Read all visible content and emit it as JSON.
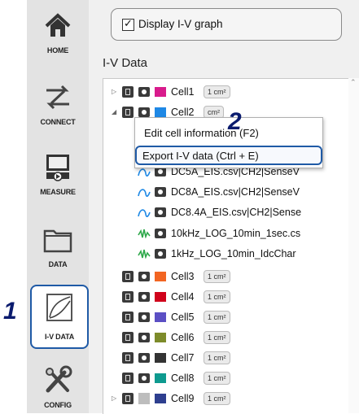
{
  "callouts": {
    "one": "1",
    "two": "2"
  },
  "nav": [
    {
      "label": "HOME",
      "icon": "home-icon"
    },
    {
      "label": "CONNECT",
      "icon": "connect-icon"
    },
    {
      "label": "MEASURE",
      "icon": "measure-icon"
    },
    {
      "label": "DATA",
      "icon": "folder-icon"
    },
    {
      "label": "I-V DATA",
      "icon": "iv-curve-icon"
    },
    {
      "label": "CONFIG",
      "icon": "config-icon"
    }
  ],
  "display_iv": {
    "label": "Display I-V graph",
    "checked": true
  },
  "iv_section_title": "I-V Data",
  "tree": {
    "cells": [
      {
        "name": "Cell1",
        "area": "1 cm²",
        "color": "#d81b8c"
      },
      {
        "name": "Cell2",
        "area": "cm²",
        "color": "#1e88e5"
      },
      {
        "name": "Cell3",
        "area": "1 cm²",
        "color": "#f26522"
      },
      {
        "name": "Cell4",
        "area": "1 cm²",
        "color": "#d0021b"
      },
      {
        "name": "Cell5",
        "area": "1 cm²",
        "color": "#5b4fc4"
      },
      {
        "name": "Cell6",
        "area": "1 cm²",
        "color": "#7d8b2a"
      },
      {
        "name": "Cell7",
        "area": "1 cm²",
        "color": "#333333"
      },
      {
        "name": "Cell8",
        "area": "1 cm²",
        "color": "#0e9a8f"
      },
      {
        "name": "Cell9",
        "area": "1 cm²",
        "color": "#2e3f8f"
      }
    ],
    "files": [
      {
        "name": "DC5A_EIS.csv|CH2|SenseV",
        "kind": "eis"
      },
      {
        "name": "DC8A_EIS.csv|CH2|SenseV",
        "kind": "eis"
      },
      {
        "name": "DC8.4A_EIS.csv|CH2|Sense",
        "kind": "eis"
      },
      {
        "name": "10kHz_LOG_10min_1sec.cs",
        "kind": "log"
      },
      {
        "name": "1kHz_LOG_10min_IdcChar",
        "kind": "log"
      }
    ]
  },
  "context_menu": {
    "edit": "Edit cell information (F2)",
    "export": "Export I-V data (Ctrl + E)"
  }
}
